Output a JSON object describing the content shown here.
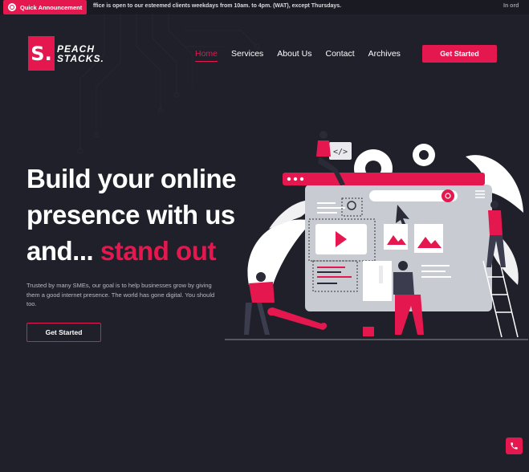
{
  "announcement": {
    "label": "Quick Announcement",
    "text": "ffice is open to our esteemed clients weekdays from 10am. to 4pm. (WAT), except Thursdays.",
    "tail": "In ord"
  },
  "brand": {
    "mark": "S.",
    "line1": "PEACH",
    "line2": "STACKS."
  },
  "nav": {
    "items": [
      {
        "label": "Home",
        "active": true
      },
      {
        "label": "Services",
        "active": false
      },
      {
        "label": "About Us",
        "active": false
      },
      {
        "label": "Contact",
        "active": false
      },
      {
        "label": "Archives",
        "active": false
      }
    ],
    "cta": "Get Started"
  },
  "hero": {
    "line1": "Build your online",
    "line2": "presence with us",
    "line3_white": "and...",
    "line3_pink": "stand out",
    "description": "Trusted by many SMEs, our goal is to help businesses grow by giving them a good internet presence. The world has gone digital. You should too.",
    "cta": "Get Started"
  },
  "colors": {
    "accent": "#e4184f",
    "background": "#1f2029"
  },
  "icons": [
    "megaphone-icon",
    "phone-icon",
    "code-icon",
    "gear-icon",
    "search-icon",
    "play-icon",
    "image-icon",
    "menu-icon"
  ]
}
